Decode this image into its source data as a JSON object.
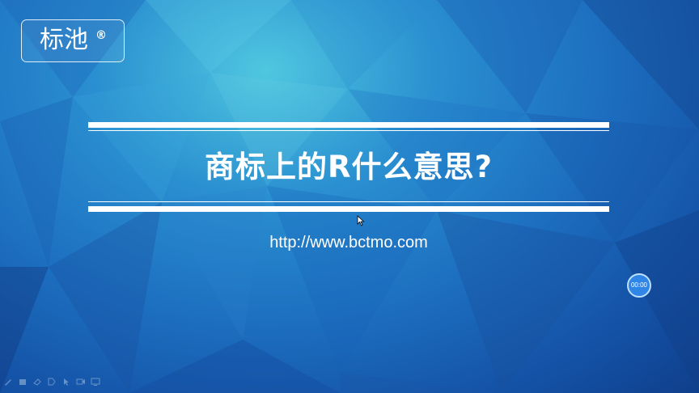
{
  "logo": {
    "text": "标池",
    "mark": "®"
  },
  "slide": {
    "title": "商标上的R什么意思?",
    "url": "http://www.bctmo.com"
  },
  "player": {
    "timer": "00:00"
  },
  "toolbar": {
    "icons": [
      "pen-icon",
      "highlighter-icon",
      "eraser-icon",
      "tag-icon",
      "pointer-icon",
      "video-icon",
      "screen-icon"
    ]
  },
  "colors": {
    "bg_dark": "#0f3f8c",
    "bg_mid": "#1d6fc0",
    "bg_light": "#4fc7e0",
    "accent": "#2f86e6",
    "text": "#ffffff"
  }
}
